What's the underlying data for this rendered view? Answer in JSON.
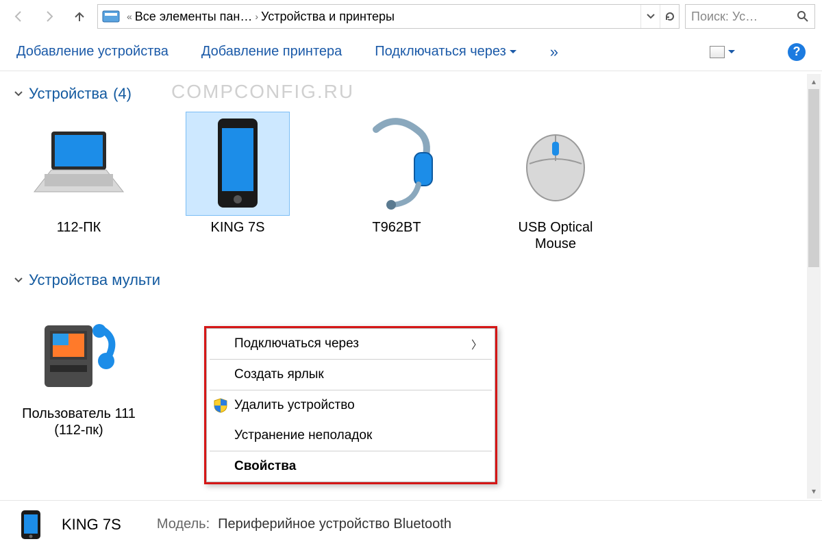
{
  "addressbar": {
    "crumb_root": "Все элементы пан…",
    "crumb_current": "Устройства и принтеры"
  },
  "search": {
    "placeholder": "Поиск: Ус…"
  },
  "toolbar": {
    "add_device": "Добавление устройства",
    "add_printer": "Добавление принтера",
    "connect_via": "Подключаться через",
    "more": "»"
  },
  "help_tooltip": "?",
  "watermark": "COMPCONFIG.RU",
  "groups": {
    "devices": {
      "title": "Устройства",
      "count": "(4)"
    },
    "multimedia": {
      "title": "Устройства мульти"
    }
  },
  "devices": [
    {
      "label": "112-ПК",
      "icon": "laptop",
      "selected": false
    },
    {
      "label": "KING 7S",
      "icon": "phone",
      "selected": true
    },
    {
      "label": "T962BT",
      "icon": "headset",
      "selected": false
    },
    {
      "label": "USB Optical Mouse",
      "icon": "mouse",
      "selected": false
    }
  ],
  "multimedia_devices": [
    {
      "label": "Пользователь 111 (112-пк)",
      "icon": "media-player"
    }
  ],
  "context_menu": {
    "connect_via": "Подключаться через",
    "create_shortcut": "Создать ярлык",
    "remove_device": "Удалить устройство",
    "troubleshoot": "Устранение неполадок",
    "properties": "Свойства"
  },
  "details": {
    "name": "KING 7S",
    "model_label": "Модель:",
    "model_value": "Периферийное устройство Bluetooth"
  }
}
